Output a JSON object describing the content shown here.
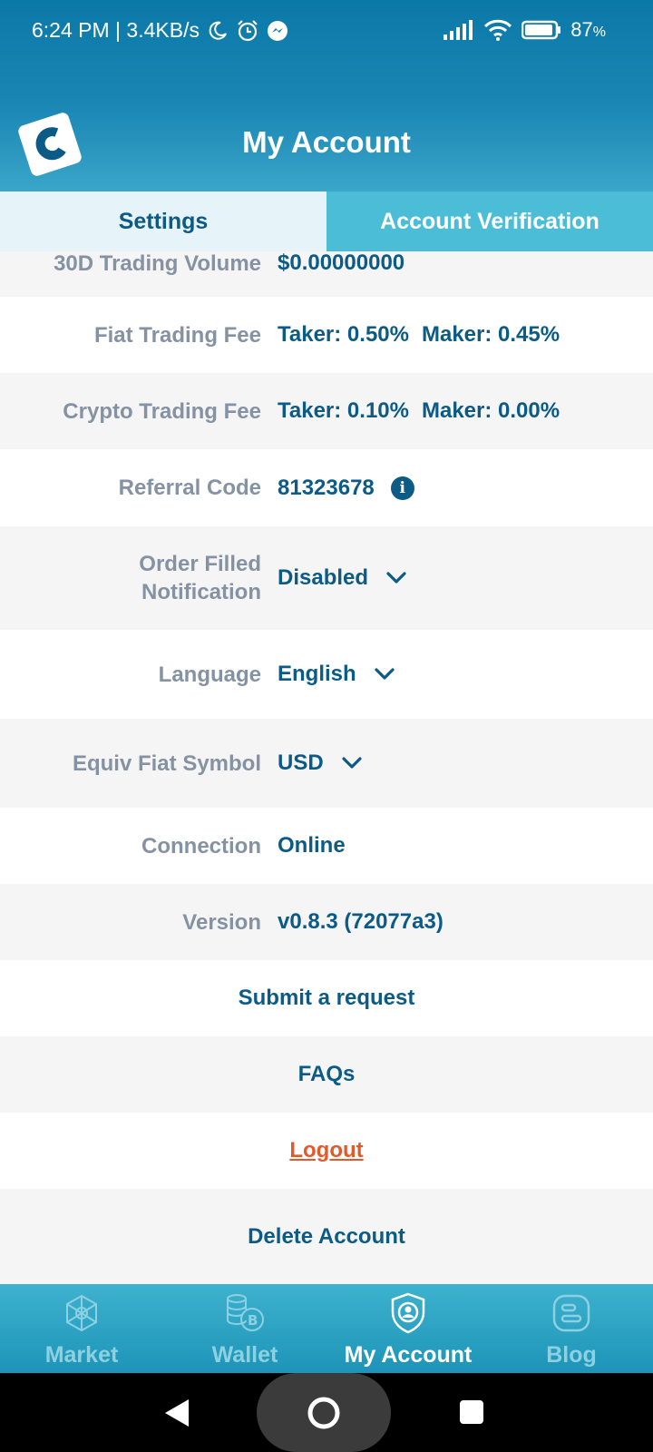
{
  "status_bar": {
    "time_speed": "6:24 PM | 3.4KB/s",
    "battery": "87",
    "battery_unit": "%"
  },
  "header": {
    "title": "My Account"
  },
  "tabs": [
    {
      "label": "Settings",
      "selected": true
    },
    {
      "label": "Account Verification",
      "selected": false
    }
  ],
  "rows": {
    "trading_volume": {
      "label": "30D Trading Volume",
      "value": "$0.00000000"
    },
    "fiat_fee": {
      "label": "Fiat Trading Fee",
      "taker": "Taker: 0.50%",
      "maker": "Maker: 0.45%"
    },
    "crypto_fee": {
      "label": "Crypto Trading Fee",
      "taker": "Taker: 0.10%",
      "maker": "Maker: 0.00%"
    },
    "referral": {
      "label": "Referral Code",
      "value": "81323678",
      "info_glyph": "i"
    },
    "order_notification": {
      "label_line1": "Order Filled",
      "label_line2": "Notification",
      "value": "Disabled"
    },
    "language": {
      "label": "Language",
      "value": "English"
    },
    "fiat_symbol": {
      "label": "Equiv Fiat Symbol",
      "value": "USD"
    },
    "connection": {
      "label": "Connection",
      "value": "Online"
    },
    "version": {
      "label": "Version",
      "value": "v0.8.3 (72077a3)"
    }
  },
  "links": {
    "submit_request": "Submit a request",
    "faqs": "FAQs",
    "logout": "Logout",
    "delete_account": "Delete Account"
  },
  "bottom_nav": [
    {
      "label": "Market",
      "icon": "network-icon",
      "active": false
    },
    {
      "label": "Wallet",
      "icon": "coins-icon",
      "active": false
    },
    {
      "label": "My Account",
      "icon": "shield-user-icon",
      "active": true
    },
    {
      "label": "Blog",
      "icon": "blog-icon",
      "active": false
    }
  ],
  "colors": {
    "brand_blue": "#0c5b86",
    "header_blue": "#0b79a8",
    "tab_cyan": "#4bbdd6",
    "logout_orange": "#e05a2b",
    "label_grey": "#8592a3"
  }
}
